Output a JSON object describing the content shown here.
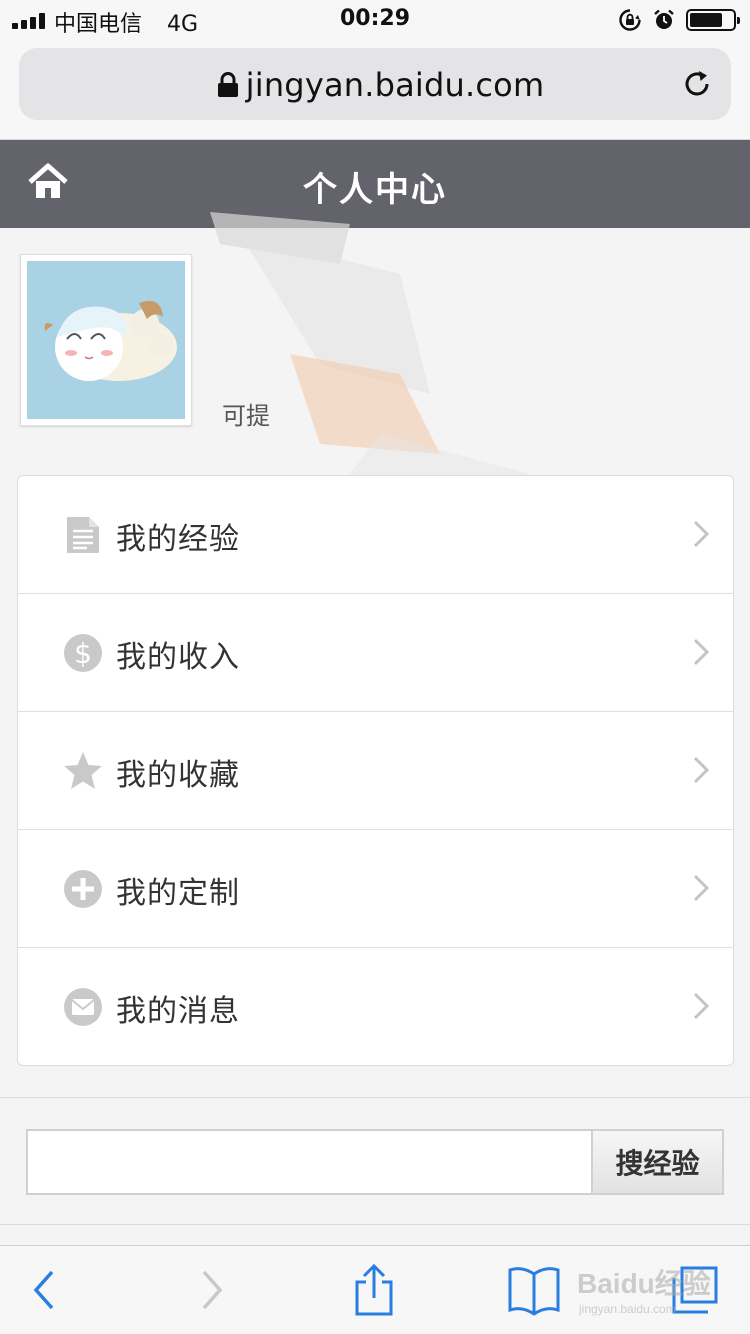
{
  "status_bar": {
    "carrier": "中国电信",
    "network": "4G",
    "time": "00:29",
    "battery_level": 0.75
  },
  "browser": {
    "url": "jingyan.baidu.com"
  },
  "header": {
    "title": "个人中心"
  },
  "profile": {
    "hint_text": "可提"
  },
  "menu": {
    "items": [
      {
        "label": "我的经验",
        "icon": "document-icon"
      },
      {
        "label": "我的收入",
        "icon": "dollar-icon"
      },
      {
        "label": "我的收藏",
        "icon": "star-icon"
      },
      {
        "label": "我的定制",
        "icon": "plus-circle-icon"
      },
      {
        "label": "我的消息",
        "icon": "envelope-icon"
      }
    ]
  },
  "search": {
    "value": "",
    "button_label": "搜经验"
  },
  "watermark": {
    "title": "Baidu经验",
    "subtitle": "jingyan.baidu.com"
  },
  "colors": {
    "header_bg": "#62636b",
    "icon_gray": "#c8c8c8",
    "ios_blue": "#2a7ee0"
  }
}
